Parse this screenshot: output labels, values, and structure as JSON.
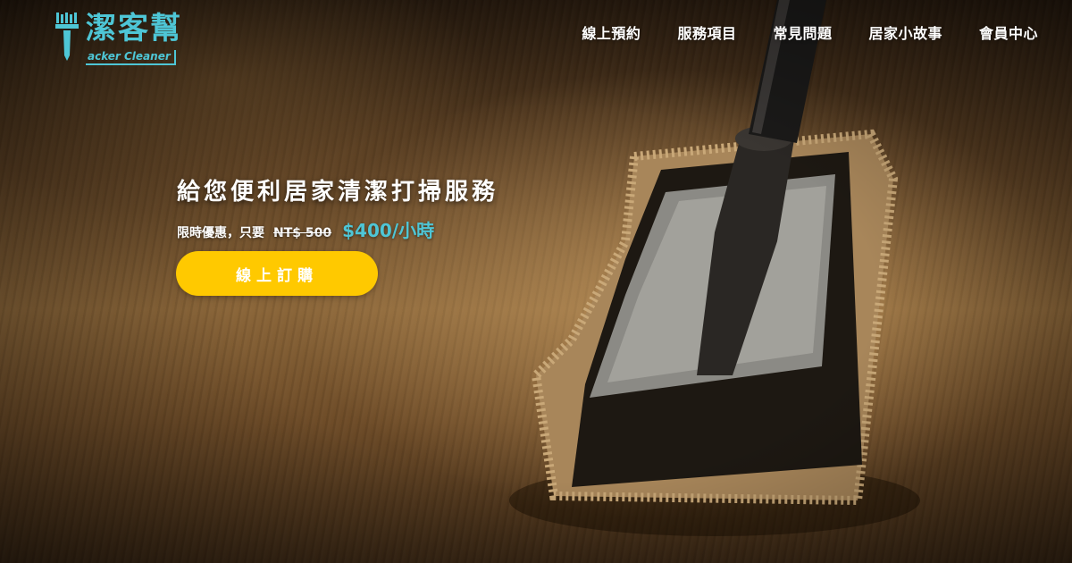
{
  "brand": {
    "name": "潔客幫",
    "subtitle": "acker Cleaner",
    "icon": "brush-cleaner-logo-icon",
    "accent_color": "#4ec6d6"
  },
  "nav": {
    "items": [
      {
        "label": "線上預約"
      },
      {
        "label": "服務項目"
      },
      {
        "label": "常見問題"
      },
      {
        "label": "居家小故事"
      },
      {
        "label": "會員中心"
      }
    ]
  },
  "hero": {
    "headline": "給您便利居家清潔打掃服務",
    "promo_label": "限時優惠，只要",
    "old_price": "NT$ 500",
    "new_price": "$400/小時",
    "cta_label": "線上訂購",
    "cta_color": "#ffc900",
    "background_image": "mop-on-wooden-floor"
  }
}
